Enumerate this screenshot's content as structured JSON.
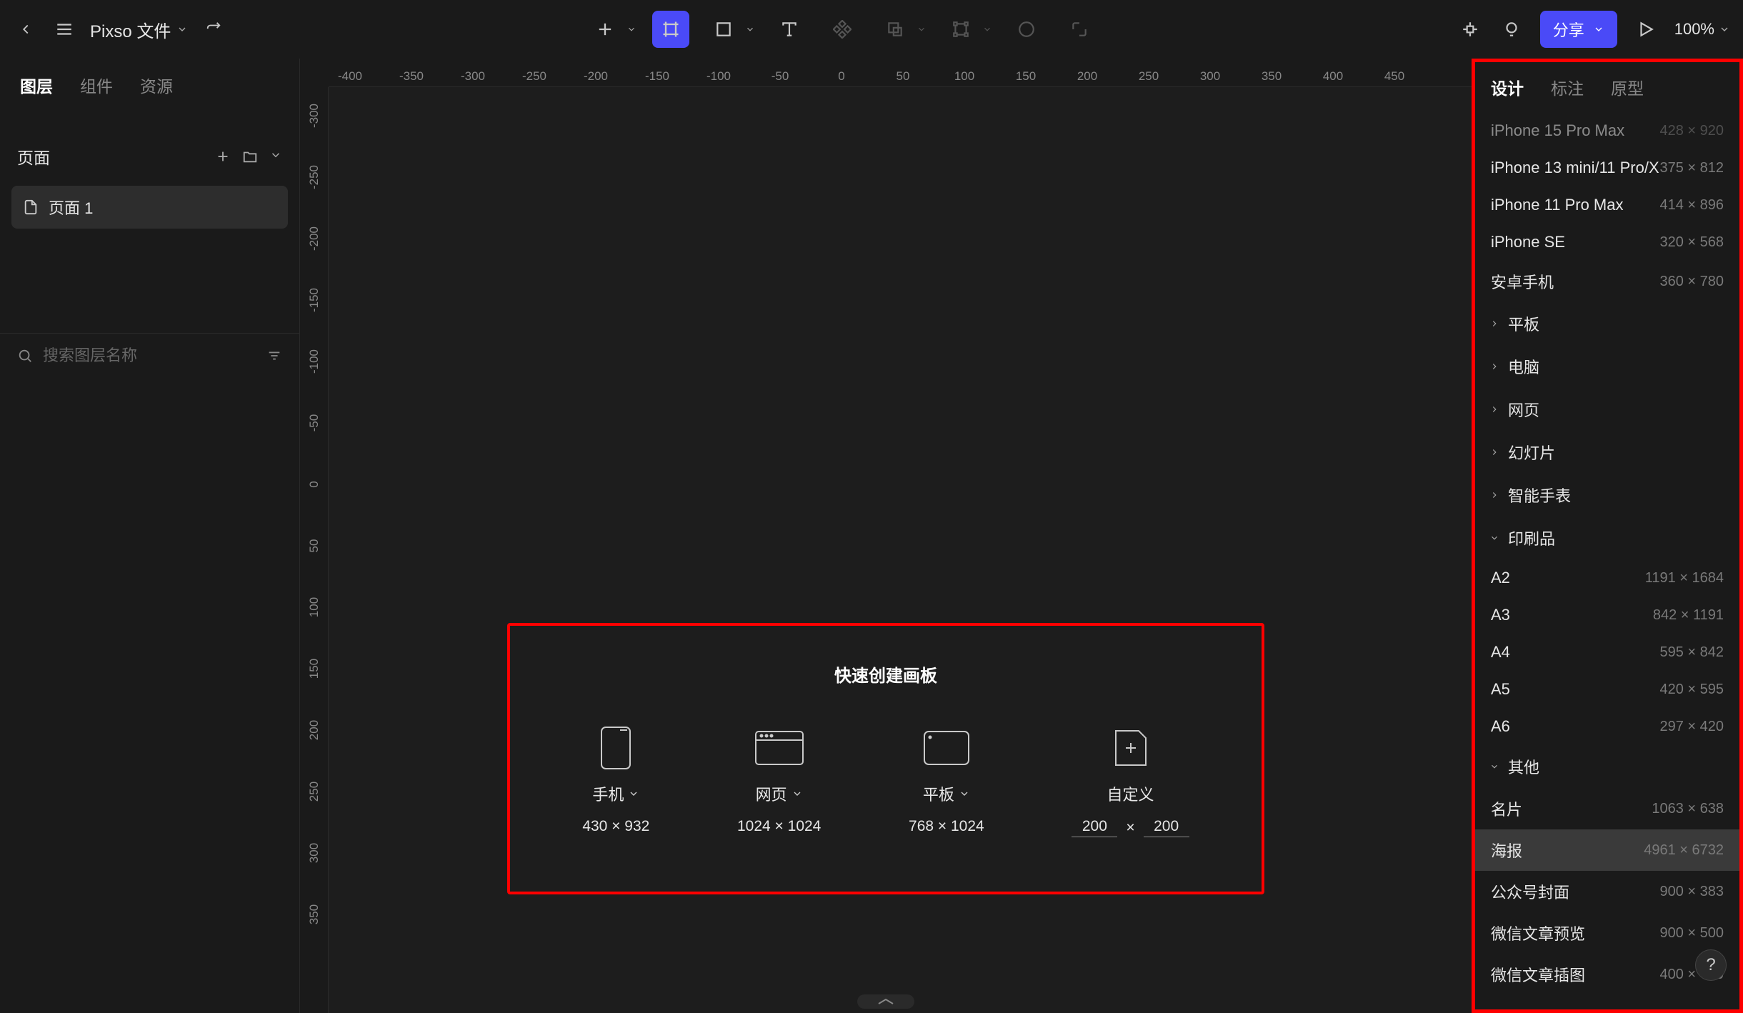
{
  "header": {
    "file_title": "Pixso 文件",
    "share_label": "分享",
    "zoom": "100%"
  },
  "left_panel": {
    "tabs": [
      "图层",
      "组件",
      "资源"
    ],
    "pages_label": "页面",
    "page_name": "页面 1",
    "search_placeholder": "搜索图层名称"
  },
  "ruler_h": [
    "-400",
    "-350",
    "-300",
    "-250",
    "-200",
    "-150",
    "-100",
    "-50",
    "0",
    "50",
    "100",
    "150",
    "200",
    "250",
    "300",
    "350",
    "400",
    "450"
  ],
  "ruler_v": [
    "-300",
    "-250",
    "-200",
    "-150",
    "-100",
    "-50",
    "0",
    "50",
    "100",
    "150",
    "200",
    "250",
    "300",
    "350"
  ],
  "quick_panel": {
    "title": "快速创建画板",
    "items": [
      {
        "label": "手机",
        "dim": "430 × 932",
        "caret": true
      },
      {
        "label": "网页",
        "dim": "1024 × 1024",
        "caret": true
      },
      {
        "label": "平板",
        "dim": "768 × 1024",
        "caret": true
      }
    ],
    "custom_label": "自定义",
    "custom_w": "200",
    "custom_h": "200",
    "times": "×"
  },
  "right_panel": {
    "tabs": [
      "设计",
      "标注",
      "原型"
    ],
    "frames_top": [
      {
        "name": "iPhone 15 Pro Max",
        "dim": "428 × 920",
        "cut": true
      },
      {
        "name": "iPhone 13 mini/11 Pro/X",
        "dim": "375 × 812"
      },
      {
        "name": "iPhone 11 Pro Max",
        "dim": "414 × 896"
      },
      {
        "name": "iPhone SE",
        "dim": "320 × 568"
      },
      {
        "name": "安卓手机",
        "dim": "360 × 780"
      }
    ],
    "cats_collapsed": [
      "平板",
      "电脑",
      "网页",
      "幻灯片",
      "智能手表"
    ],
    "cat_print": "印刷品",
    "frames_print": [
      {
        "name": "A2",
        "dim": "1191 × 1684"
      },
      {
        "name": "A3",
        "dim": "842 × 1191"
      },
      {
        "name": "A4",
        "dim": "595 × 842"
      },
      {
        "name": "A5",
        "dim": "420 × 595"
      },
      {
        "name": "A6",
        "dim": "297 × 420"
      }
    ],
    "cat_other": "其他",
    "frames_other": [
      {
        "name": "名片",
        "dim": "1063 × 638"
      },
      {
        "name": "海报",
        "dim": "4961 × 6732",
        "selected": true
      },
      {
        "name": "公众号封面",
        "dim": "900 × 383"
      },
      {
        "name": "微信文章预览",
        "dim": "900 × 500"
      },
      {
        "name": "微信文章插图",
        "dim": "400 × 400"
      }
    ],
    "help": "?"
  }
}
